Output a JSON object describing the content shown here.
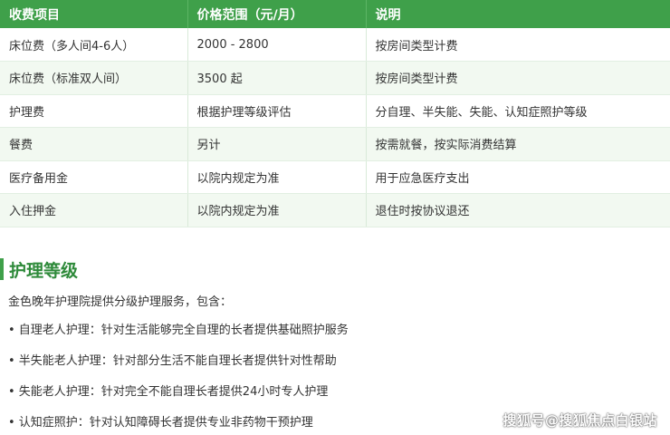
{
  "fee_table": {
    "headers": [
      "收费项目",
      "价格范围（元/月）",
      "说明"
    ],
    "rows": [
      [
        "床位费（多人间4-6人）",
        "2000 - 2800",
        "按房间类型计费"
      ],
      [
        "床位费（标准双人间）",
        "3500 起",
        "按房间类型计费"
      ],
      [
        "护理费",
        "根据护理等级评估",
        "分自理、半失能、失能、认知症照护等级"
      ],
      [
        "餐费",
        "另计",
        "按需就餐，按实际消费结算"
      ],
      [
        "医疗备用金",
        "以院内规定为准",
        "用于应急医疗支出"
      ],
      [
        "入住押金",
        "以院内规定为准",
        "退住时按协议退还"
      ]
    ]
  },
  "care_levels": {
    "title": "护理等级",
    "intro": "金色晚年护理院提供分级护理服务，包含：",
    "items": [
      "• 自理老人护理：针对生活能够完全自理的长者提供基础照护服务",
      "• 半失能老人护理：针对部分生活不能自理长者提供针对性帮助",
      "• 失能老人护理：针对完全不能自理长者提供24小时专人护理",
      "• 认知症照护：针对认知障碍长者提供专业非药物干预护理"
    ]
  },
  "watermark": "搜狐号@搜狐焦点白银站",
  "colors": {
    "accent": "#3fa04a",
    "title_green": "#2e8a3a",
    "row_alt": "#f2f9f1"
  }
}
